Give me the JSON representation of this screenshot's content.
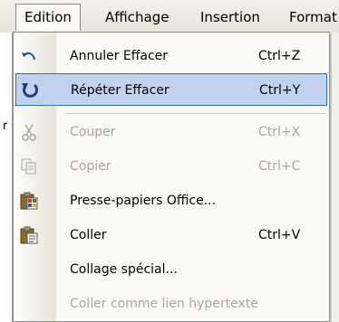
{
  "menubar": {
    "items": [
      {
        "label": "Edition"
      },
      {
        "label": "Affichage"
      },
      {
        "label": "Insertion"
      },
      {
        "label": "Format"
      }
    ]
  },
  "background": {
    "marker": "r"
  },
  "edit_menu": {
    "items": [
      {
        "label": "Annuler Effacer",
        "shortcut": "Ctrl+Z",
        "icon": "undo-icon",
        "enabled": true
      },
      {
        "label": "Répéter Effacer",
        "shortcut": "Ctrl+Y",
        "icon": "redo-icon",
        "enabled": true,
        "highlighted": true
      },
      {
        "label": "Couper",
        "shortcut": "Ctrl+X",
        "icon": "scissors-icon",
        "enabled": false
      },
      {
        "label": "Copier",
        "shortcut": "Ctrl+C",
        "icon": "copy-icon",
        "enabled": false
      },
      {
        "label": "Presse-papiers Office...",
        "shortcut": "",
        "icon": "office-clipboard-icon",
        "enabled": true
      },
      {
        "label": "Coller",
        "shortcut": "Ctrl+V",
        "icon": "paste-icon",
        "enabled": true
      },
      {
        "label": "Collage spécial...",
        "shortcut": "",
        "icon": "",
        "enabled": true
      },
      {
        "label": "Coller comme lien hypertexte",
        "shortcut": "",
        "icon": "",
        "enabled": false
      }
    ]
  },
  "colors": {
    "highlight_fill": "#c1d2ee",
    "highlight_border": "#316ac5",
    "disabled_text": "#a9a69b"
  }
}
